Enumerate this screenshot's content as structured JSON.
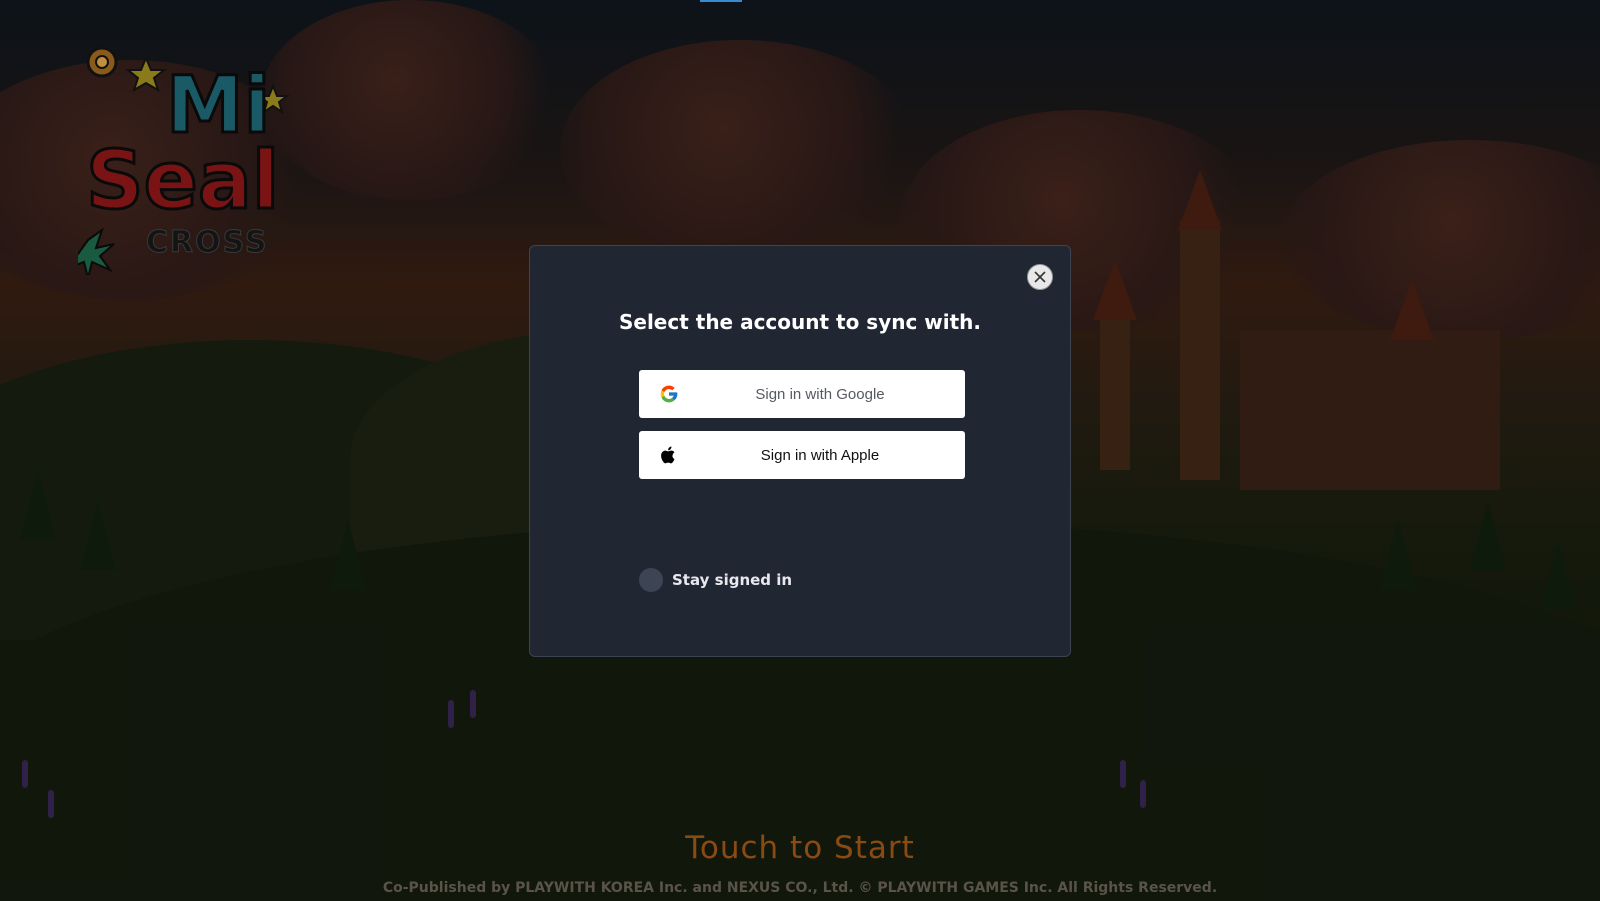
{
  "dialog": {
    "title": "Select the account to sync with.",
    "google_label": "Sign in with Google",
    "apple_label": "Sign in with Apple",
    "stay_signed_in_label": "Stay signed in",
    "stay_signed_in_checked": false
  },
  "game": {
    "logo_text_top": "Mi",
    "logo_text_main": "Seal",
    "logo_text_sub": "CROSS",
    "touch_to_start": "Touch to Start",
    "copyright": "Co-Published by PLAYWITH KOREA Inc. and NEXUS CO., Ltd. © PLAYWITH GAMES Inc. All Rights Reserved."
  },
  "icons": {
    "close": "close-icon",
    "google": "google-icon",
    "apple": "apple-icon"
  },
  "colors": {
    "dialog_bg": "#212633",
    "button_bg": "#ffffff",
    "title_text": "#ffffff",
    "touch_to_start": "#8a4a14"
  }
}
